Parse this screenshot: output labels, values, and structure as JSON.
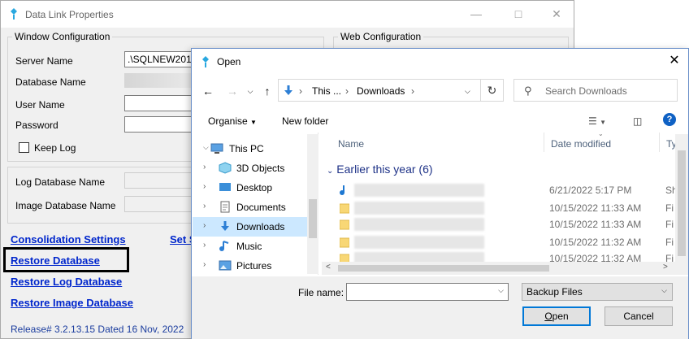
{
  "bg_window": {
    "title": "Data Link Properties",
    "window_config_label": "Window Configuration",
    "web_config_label": "Web Configuration",
    "server_name_label": "Server Name",
    "server_name_value": ".\\SQLNEW2019",
    "database_name_label": "Database Name",
    "user_name_label": "User Name",
    "password_label": "Password",
    "keep_log_label": "Keep Log",
    "log_db_label": "Log Database Name",
    "image_db_label": "Image Database Name",
    "links": {
      "consolidation": "Consolidation Settings",
      "set_partial": "Set S",
      "restore_db": "Restore Database",
      "restore_log": "Restore Log Database",
      "restore_image": "Restore Image Database"
    },
    "release": "Release# 3.2.13.15  Dated 16 Nov, 2022"
  },
  "dialog": {
    "title": "Open",
    "breadcrumb": [
      "This ...",
      "Downloads"
    ],
    "search_placeholder": "Search Downloads",
    "toolbar": {
      "organise": "Organise",
      "new_folder": "New folder"
    },
    "tree": [
      {
        "label": "This PC",
        "icon": "pc-icon",
        "chevron": "⌵"
      },
      {
        "label": "3D Objects",
        "icon": "cube-icon",
        "chevron": "›"
      },
      {
        "label": "Desktop",
        "icon": "desktop-icon",
        "chevron": "›"
      },
      {
        "label": "Documents",
        "icon": "documents-icon",
        "chevron": "›"
      },
      {
        "label": "Downloads",
        "icon": "downloads-icon",
        "chevron": "›"
      },
      {
        "label": "Music",
        "icon": "music-icon",
        "chevron": "›"
      },
      {
        "label": "Pictures",
        "icon": "pictures-icon",
        "chevron": "›"
      }
    ],
    "columns": {
      "name": "Name",
      "date_modified": "Date modified",
      "type": "Ty"
    },
    "group_header": "Earlier this year (6)",
    "rows": [
      {
        "date": "6/21/2022 5:17 PM",
        "type": "Sh",
        "icon": "audio-file-icon"
      },
      {
        "date": "10/15/2022 11:33 AM",
        "type": "Fi",
        "icon": "folder-icon"
      },
      {
        "date": "10/15/2022 11:33 AM",
        "type": "Fi",
        "icon": "folder-icon"
      },
      {
        "date": "10/15/2022 11:32 AM",
        "type": "Fi",
        "icon": "folder-icon"
      },
      {
        "date": "10/15/2022 11:32 AM",
        "type": "Fi",
        "icon": "folder-icon"
      }
    ],
    "file_name_label": "File name:",
    "file_type_value": "Backup Files",
    "open_label": "Open",
    "cancel_label": "Cancel"
  },
  "colors": {
    "accent": "#0078d7",
    "link": "#0026cc",
    "selection": "#cce8ff"
  }
}
